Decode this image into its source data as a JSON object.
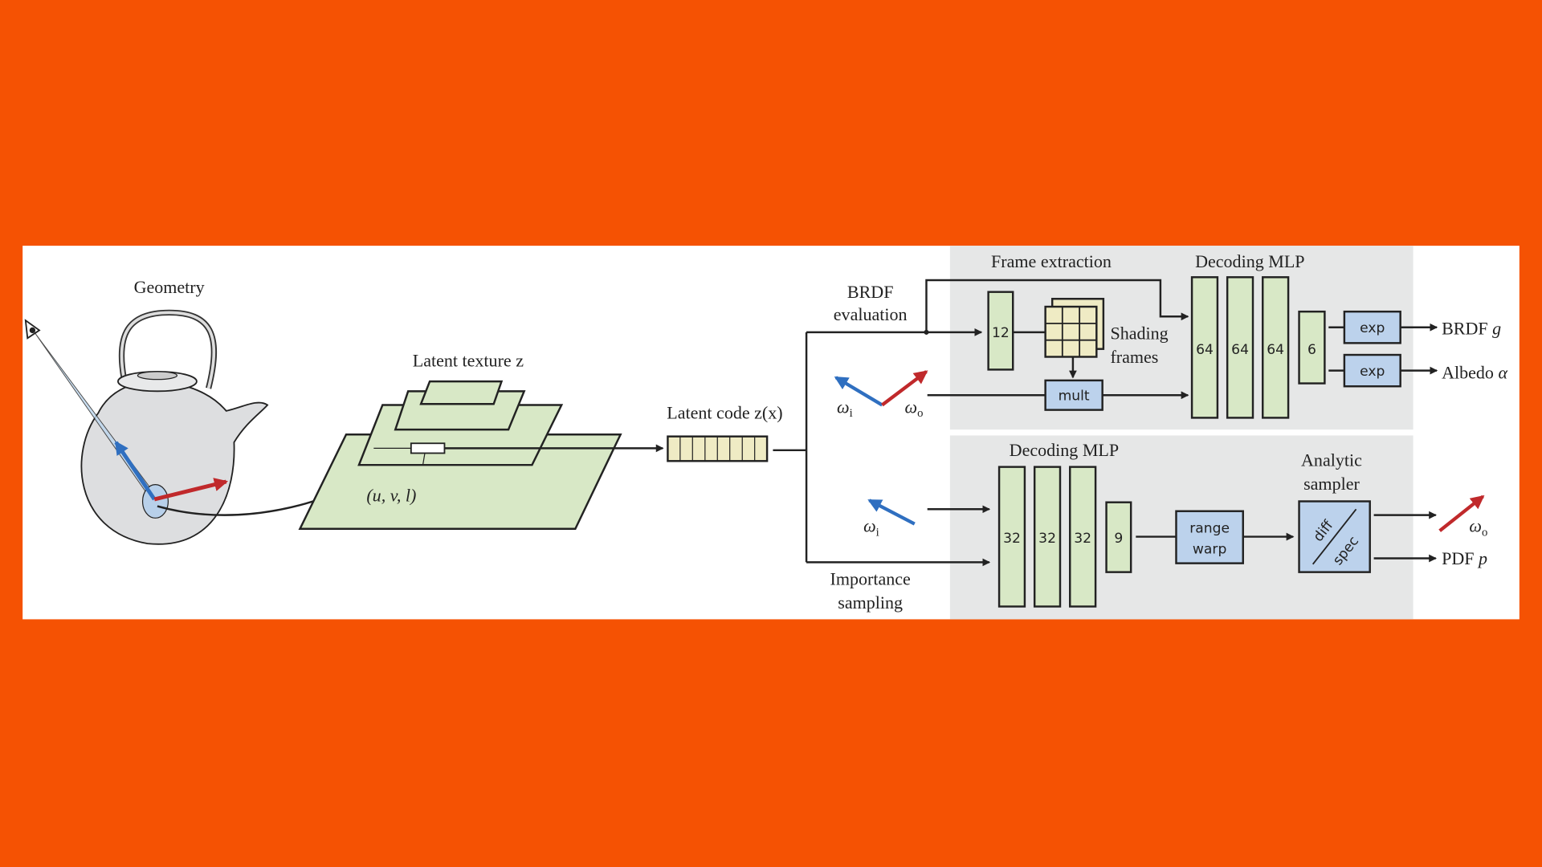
{
  "colors": {
    "background": "#F55203",
    "panel": "#FFFFFF",
    "section_bg": "#E6E7E7",
    "layer_green": "#D8E8C6",
    "op_blue": "#BCD2EC",
    "wi_arrow": "#2F6FC0",
    "wo_arrow": "#C0292B"
  },
  "left": {
    "geometry_label": "Geometry",
    "latent_texture_label": "Latent texture z",
    "uvl_label": "(u, v, l)",
    "latent_code_label": "Latent code z(x)"
  },
  "branch": {
    "brdf_eval_line1": "BRDF",
    "brdf_eval_line2": "evaluation",
    "importance_line1": "Importance",
    "importance_line2": "sampling"
  },
  "top": {
    "frame_extraction": "Frame extraction",
    "decoding_mlp": "Decoding MLP",
    "layer_12": "12",
    "shading_line1": "Shading",
    "shading_line2": "frames",
    "mult": "mult",
    "layers": [
      "64",
      "64",
      "64",
      "6"
    ],
    "exp1": "exp",
    "exp2": "exp",
    "brdf_out": "BRDF",
    "brdf_sym": "g",
    "albedo_out": "Albedo",
    "albedo_sym": "α",
    "omega": "ω",
    "sub_i": "i",
    "sub_o": "o"
  },
  "bottom": {
    "decoding_mlp": "Decoding MLP",
    "layers": [
      "32",
      "32",
      "32",
      "9"
    ],
    "range": "range",
    "warp": "warp",
    "analytic_line1": "Analytic",
    "analytic_line2": "sampler",
    "diff": "diff",
    "spec": "spec",
    "pdf_out": "PDF",
    "pdf_sym": "p",
    "omega": "ω",
    "sub_i": "i",
    "sub_o": "o"
  }
}
